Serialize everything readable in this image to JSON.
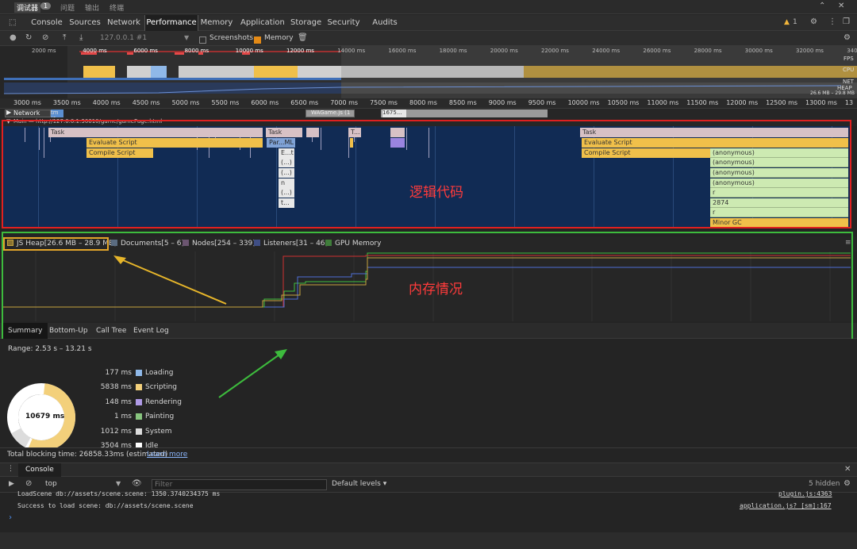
{
  "window": {
    "tabs": [
      "调试器",
      "问题",
      "输出",
      "终端"
    ],
    "badge": "1"
  },
  "devtools": {
    "tabs": [
      "Console",
      "Sources",
      "Network",
      "Performance",
      "Memory",
      "Application",
      "Storage",
      "Security",
      "Audits"
    ],
    "active_tab": "Performance",
    "warning_count": "1"
  },
  "perf_toolbar": {
    "target": "127.0.0.1 #1",
    "screenshots_label": "Screenshots",
    "memory_label": "Memory",
    "screenshots_checked": false,
    "memory_checked": true
  },
  "overview": {
    "ticks": [
      "2000 ms",
      "4000 ms",
      "6000 ms",
      "8000 ms",
      "10000 ms",
      "12000 ms",
      "14000 ms",
      "16000 ms",
      "18000 ms",
      "20000 ms",
      "22000 ms",
      "24000 ms",
      "26000 ms",
      "28000 ms",
      "30000 ms",
      "32000 ms",
      "340"
    ],
    "labels": [
      "FPS",
      "CPU",
      "NET",
      "HEAP"
    ],
    "heap_range": "26.6 MB – 29.8 MB"
  },
  "ruler": {
    "ticks": [
      "3000 ms",
      "3500 ms",
      "4000 ms",
      "4500 ms",
      "5000 ms",
      "5500 ms",
      "6000 ms",
      "6500 ms",
      "7000 ms",
      "7500 ms",
      "8000 ms",
      "8500 ms",
      "9000 ms",
      "9500 ms",
      "10000 ms",
      "10500 ms",
      "11000 ms",
      "11500 ms",
      "12000 ms",
      "12500 ms",
      "13000 ms",
      "13"
    ]
  },
  "network": {
    "label": "Network",
    "items": [
      "tm (1...",
      "WAGame.js (1",
      "1675..."
    ]
  },
  "main_thread": {
    "label": "Main — http://127.0.0.1:30610/game/gamePage.html",
    "blocks": {
      "task": "Task",
      "evaluate": "Evaluate Script",
      "compile": "Compile Script",
      "par": "Par...ML",
      "et": "E...t",
      "paren": "(...)",
      "n": "n",
      "t": "t...",
      "anon": "(anonymous)",
      "r": "r",
      "n2874": "2874",
      "minor_gc": "Minor GC",
      "t_short": "T..."
    }
  },
  "annotations": {
    "code": "逻辑代码",
    "memory": "内存情况"
  },
  "memory_legend": [
    {
      "label": "JS Heap[26.6 MB – 28.9 MB]",
      "color": "#c7a43f"
    },
    {
      "label": "Documents[5 – 6]",
      "color": "#5a6b80"
    },
    {
      "label": "Nodes[254 – 339]",
      "color": "#6b5570"
    },
    {
      "label": "Listeners[31 – 46]",
      "color": "#3f4e84"
    },
    {
      "label": "GPU Memory",
      "color": "#3f7d3a"
    }
  ],
  "bottom_tabs": [
    "Summary",
    "Bottom-Up",
    "Call Tree",
    "Event Log"
  ],
  "summary": {
    "range": "Range: 2.53 s – 13.21 s",
    "total": "10679 ms",
    "rows": [
      {
        "ms": "177 ms",
        "label": "Loading",
        "color": "#8fb8e8"
      },
      {
        "ms": "5838 ms",
        "label": "Scripting",
        "color": "#f3d07b"
      },
      {
        "ms": "148 ms",
        "label": "Rendering",
        "color": "#af9ae6"
      },
      {
        "ms": "1 ms",
        "label": "Painting",
        "color": "#87c47e"
      },
      {
        "ms": "1012 ms",
        "label": "System",
        "color": "#dcdcdc"
      },
      {
        "ms": "3504 ms",
        "label": "Idle",
        "color": "#ffffff"
      }
    ]
  },
  "tbt": {
    "text": "Total blocking time: 26858.33ms (estimated)",
    "link": "Learn more"
  },
  "drawer": {
    "tab": "Console",
    "context": "top",
    "filter_placeholder": "Filter",
    "levels": "Default levels",
    "hidden": "5 hidden",
    "lines": [
      {
        "text": "LoadScene db://assets/scene.scene: 1350.3740234375 ms",
        "src": "plugin.js:4363"
      },
      {
        "text": "Success to load scene: db://assets/scene.scene",
        "src": "application.js? [sm]:167"
      }
    ]
  }
}
